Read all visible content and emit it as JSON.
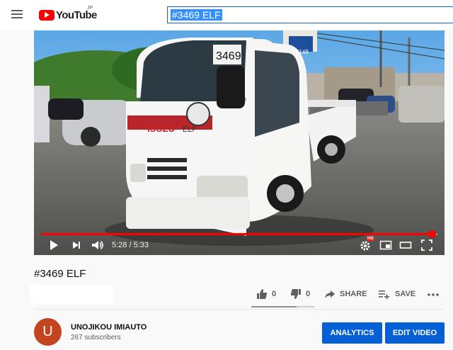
{
  "header": {
    "logo_text": "YouTube",
    "region_code": "JP",
    "search_value": "#3469 ELF"
  },
  "player": {
    "current_time": "5:28",
    "separator": " / ",
    "duration": "5:33",
    "progress": 0.985,
    "hd_badge": "HD"
  },
  "video": {
    "title": "#3469 ELF",
    "likes": "0",
    "dislikes": "0",
    "share_label": "SHARE",
    "save_label": "SAVE"
  },
  "channel": {
    "initial": "U",
    "name": "UNOJIKOU IMIAUTO",
    "subscribers": "267 subscribers"
  },
  "buttons": {
    "analytics": "ANALYTICS",
    "edit_video": "EDIT VIDEO"
  },
  "scene": {
    "truck_brand": "ISUZU",
    "truck_model": "ELF",
    "windshield_number": "3469",
    "sign_number": "5148"
  },
  "colors": {
    "brand_red": "#ff0000",
    "accent_blue": "#065fd4",
    "avatar": "#c3451f"
  }
}
